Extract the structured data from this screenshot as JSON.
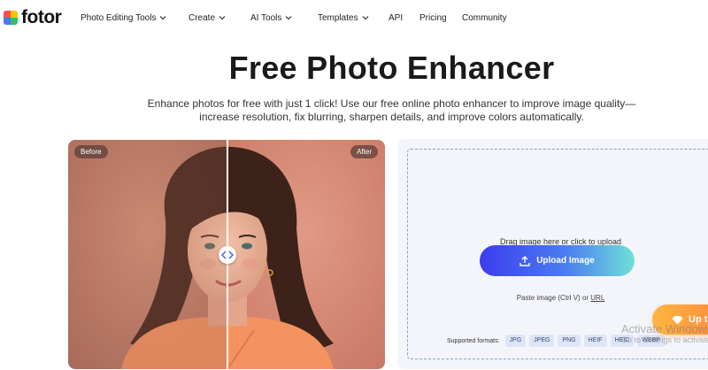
{
  "brand": {
    "logo_text": "fotor"
  },
  "nav": {
    "items": [
      {
        "label": "Photo Editing Tools",
        "dropdown": true
      },
      {
        "label": "Create",
        "dropdown": true
      },
      {
        "label": "AI Tools",
        "dropdown": true
      },
      {
        "label": "Templates",
        "dropdown": true
      },
      {
        "label": "API",
        "dropdown": false
      },
      {
        "label": "Pricing",
        "dropdown": false
      },
      {
        "label": "Community",
        "dropdown": false
      }
    ]
  },
  "hero": {
    "title": "Free Photo Enhancer",
    "subtitle": "Enhance photos for free with just 1 click! Use our free online photo enhancer to improve image quality—increase resolution, fix blurring, sharpen details, and improve colors automatically."
  },
  "compare": {
    "before_label": "Before",
    "after_label": "After",
    "split_fraction": 0.5
  },
  "upload": {
    "drag_text": "Drag image here or click to upload",
    "button_label": "Upload Image",
    "paste_prefix": "Paste image (Ctrl V) or ",
    "paste_url": "URL",
    "formats_label": "Supported formats:",
    "formats": [
      "JPG",
      "JPEG",
      "PNG",
      "HEIF",
      "HEIC",
      "WEBP"
    ]
  },
  "floating_button": {
    "label": "Up to"
  },
  "watermark": {
    "title": "Activate Windows",
    "subtitle": "Go to Settings to activate Windows."
  },
  "colors": {
    "accent_gradient_start": "#3b3df0",
    "accent_gradient_end": "#6fe0d8",
    "panel_bg": "#f3f5fa",
    "float_button": "#ff9a3d"
  },
  "icons": {
    "upload": "upload-arrow-icon",
    "nav_dropdown": "chevron-down-icon",
    "float": "diamond-icon",
    "handle": "compare-arrows-icon"
  }
}
